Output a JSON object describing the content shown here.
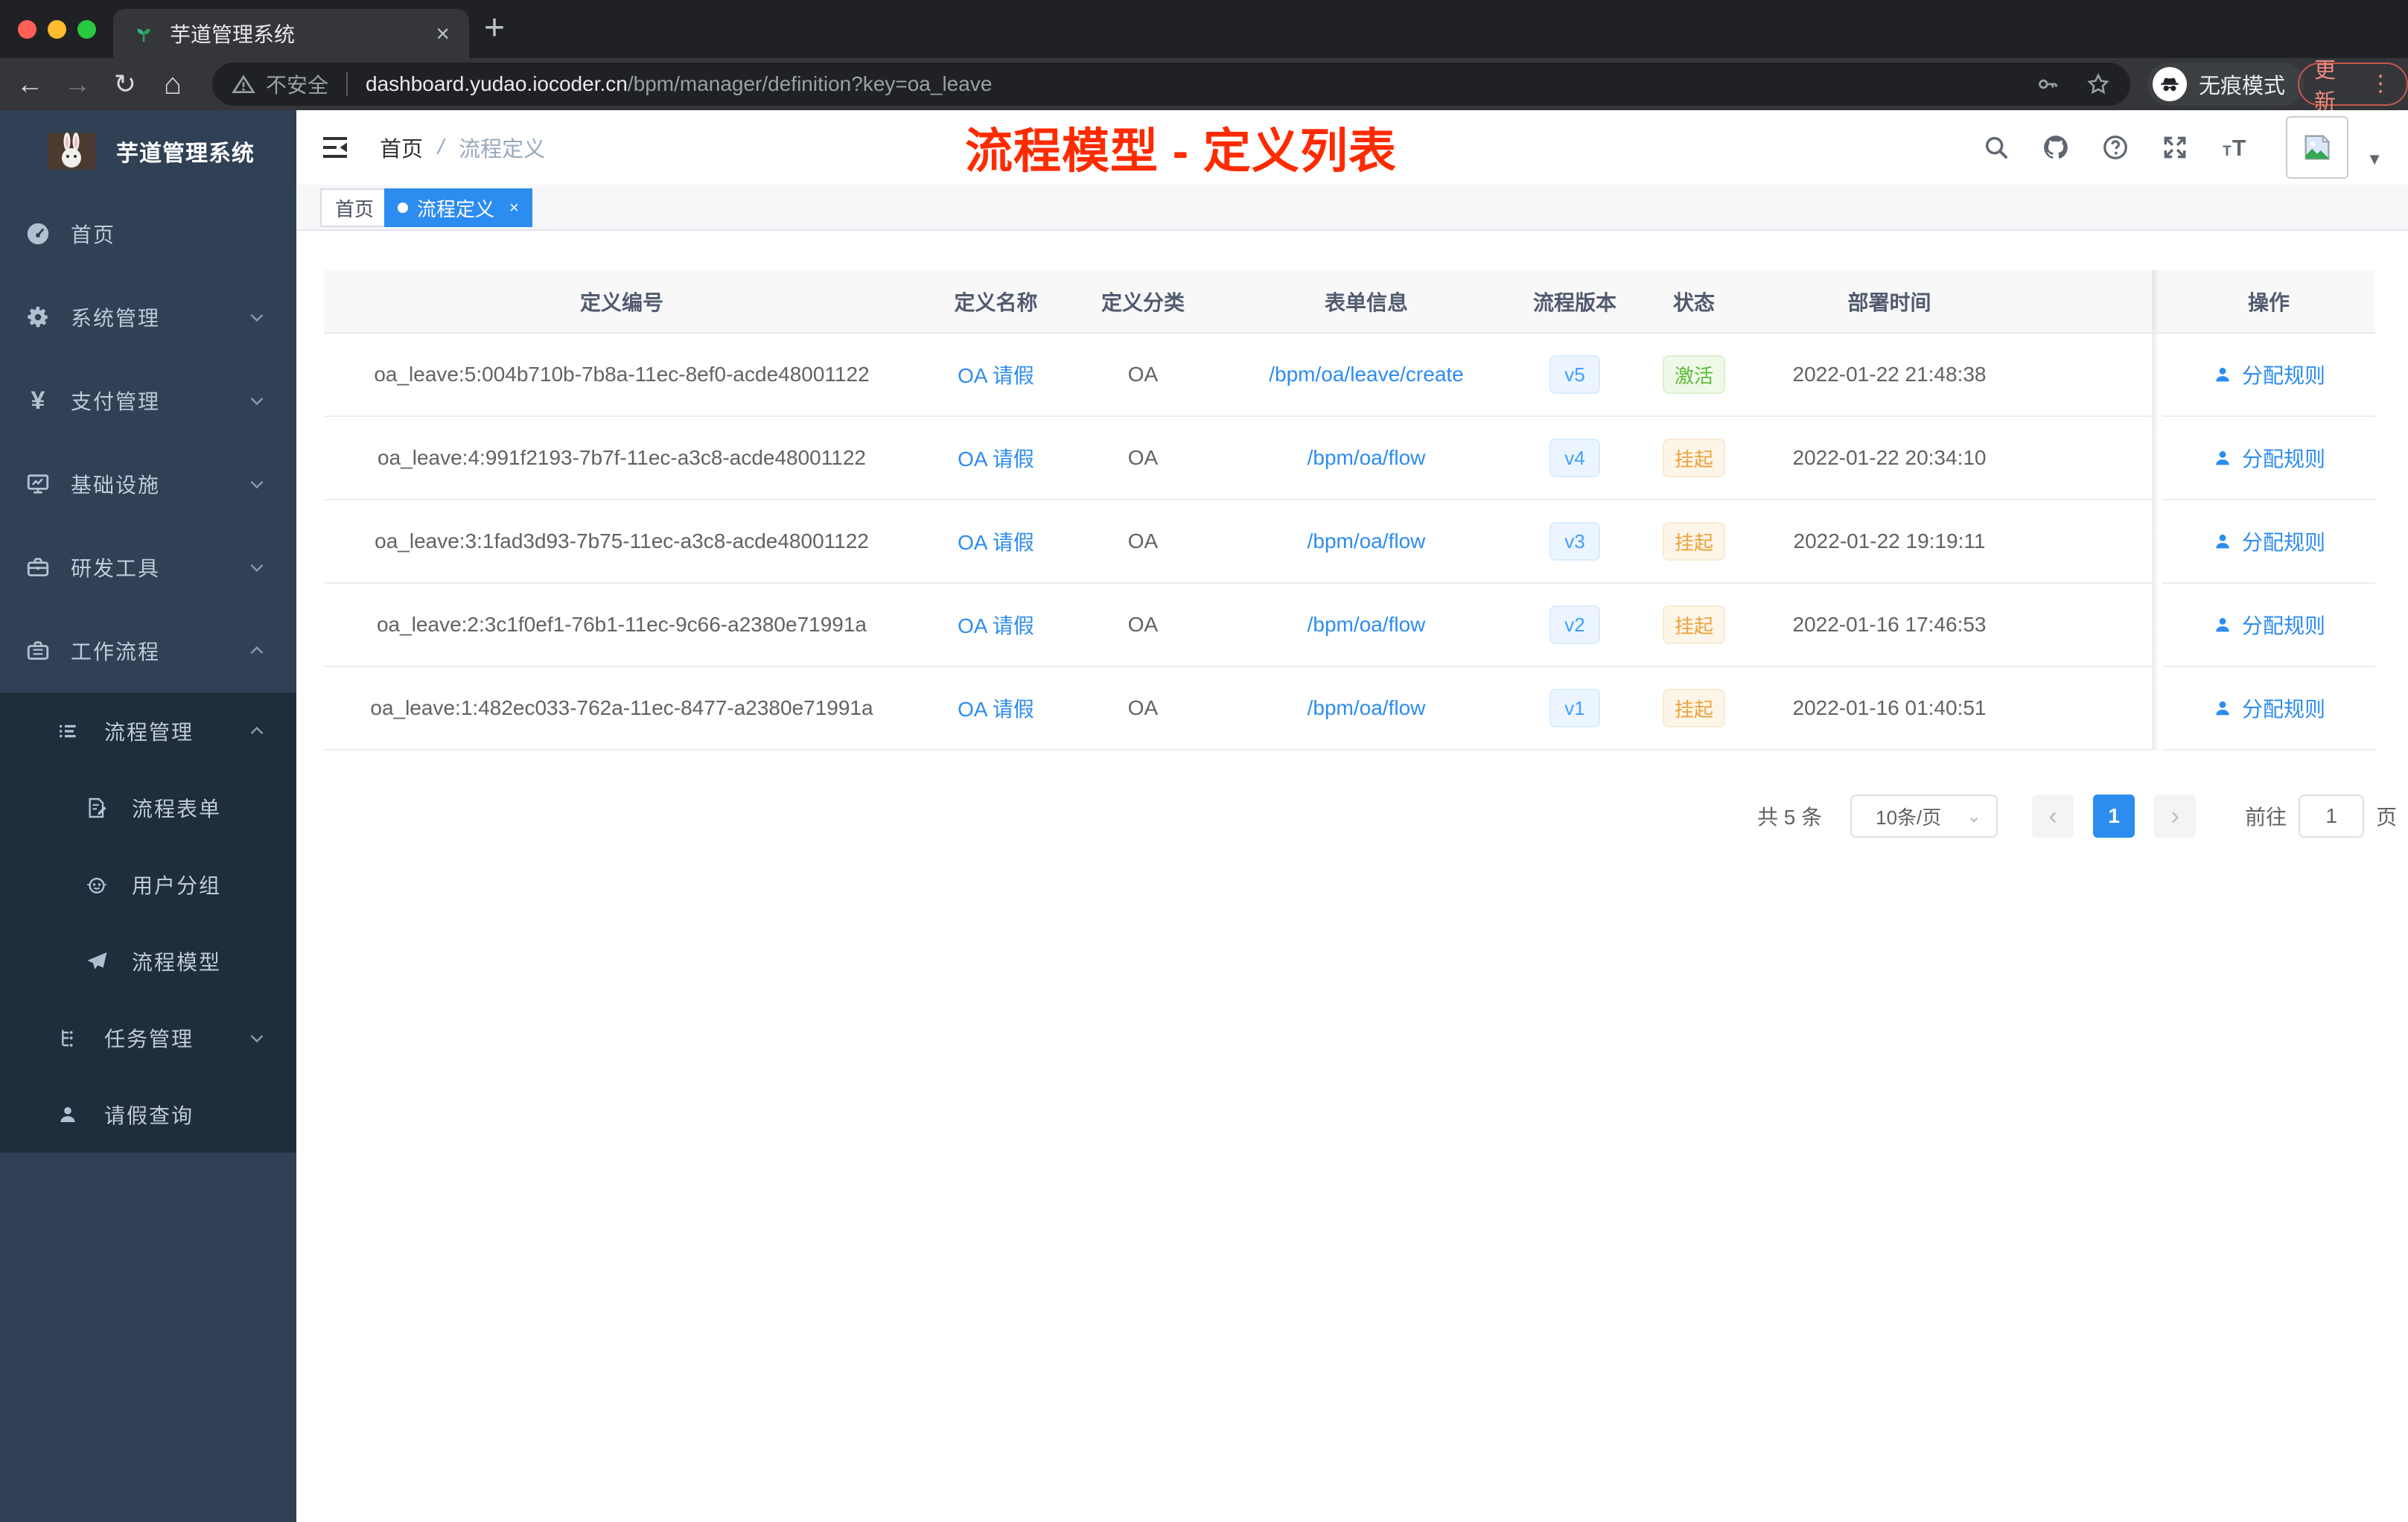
{
  "browser": {
    "tab": {
      "title": "芋道管理系统",
      "close": "×",
      "new_tab": "+"
    },
    "address": {
      "security": "不安全",
      "host": "dashboard.yudao.iocoder.cn",
      "path": "/bpm/manager/definition?key=oa_leave"
    },
    "incognito_label": "无痕模式",
    "update_label": "更新",
    "menu_dots": "⋮"
  },
  "sidebar": {
    "logo_title": "芋道管理系统",
    "items": [
      {
        "label": "首页"
      },
      {
        "label": "系统管理"
      },
      {
        "label": "支付管理"
      },
      {
        "label": "基础设施"
      },
      {
        "label": "研发工具"
      },
      {
        "label": "工作流程"
      },
      {
        "label": "流程管理"
      },
      {
        "label": "流程表单"
      },
      {
        "label": "用户分组"
      },
      {
        "label": "流程模型"
      },
      {
        "label": "任务管理"
      },
      {
        "label": "请假查询"
      }
    ]
  },
  "navbar": {
    "breadcrumb_home": "首页",
    "breadcrumb_sep": "/",
    "breadcrumb_current": "流程定义"
  },
  "annotation": {
    "text": "流程模型 - 定义列表",
    "color": "#fe2b00"
  },
  "tags": {
    "home": "首页",
    "active": "流程定义",
    "close": "×"
  },
  "table": {
    "headers": {
      "id": "定义编号",
      "name": "定义名称",
      "category": "定义分类",
      "form": "表单信息",
      "version": "流程版本",
      "status": "状态",
      "time": "部署时间",
      "action": "操作"
    },
    "rows": [
      {
        "id": "oa_leave:5:004b710b-7b8a-11ec-8ef0-acde48001122",
        "name": "OA 请假",
        "category": "OA",
        "form": "/bpm/oa/leave/create",
        "version": "v5",
        "status": "激活",
        "time": "2022-01-22 21:48:38",
        "action": "分配规则"
      },
      {
        "id": "oa_leave:4:991f2193-7b7f-11ec-a3c8-acde48001122",
        "name": "OA 请假",
        "category": "OA",
        "form": "/bpm/oa/flow",
        "version": "v4",
        "status": "挂起",
        "time": "2022-01-22 20:34:10",
        "action": "分配规则"
      },
      {
        "id": "oa_leave:3:1fad3d93-7b75-11ec-a3c8-acde48001122",
        "name": "OA 请假",
        "category": "OA",
        "form": "/bpm/oa/flow",
        "version": "v3",
        "status": "挂起",
        "time": "2022-01-22 19:19:11",
        "action": "分配规则"
      },
      {
        "id": "oa_leave:2:3c1f0ef1-76b1-11ec-9c66-a2380e71991a",
        "name": "OA 请假",
        "category": "OA",
        "form": "/bpm/oa/flow",
        "version": "v2",
        "status": "挂起",
        "time": "2022-01-16 17:46:53",
        "action": "分配规则"
      },
      {
        "id": "oa_leave:1:482ec033-762a-11ec-8477-a2380e71991a",
        "name": "OA 请假",
        "category": "OA",
        "form": "/bpm/oa/flow",
        "version": "v1",
        "status": "挂起",
        "time": "2022-01-16 01:40:51",
        "action": "分配规则"
      }
    ]
  },
  "pagination": {
    "total": "共 5 条",
    "size": "10条/页",
    "prev": "‹",
    "page": "1",
    "next": "›",
    "goto": "前往",
    "goto_value": "1",
    "unit": "页"
  },
  "colors": {
    "primary_link": "#2d8cf0",
    "tag_blue": "#409eff",
    "status_active_green": "#5dba3b",
    "status_suspend_orange": "#eda23c",
    "sidebar_bg": "#304156",
    "submenu_bg": "#1f2d3d",
    "annotation_red": "#fe2b00"
  }
}
